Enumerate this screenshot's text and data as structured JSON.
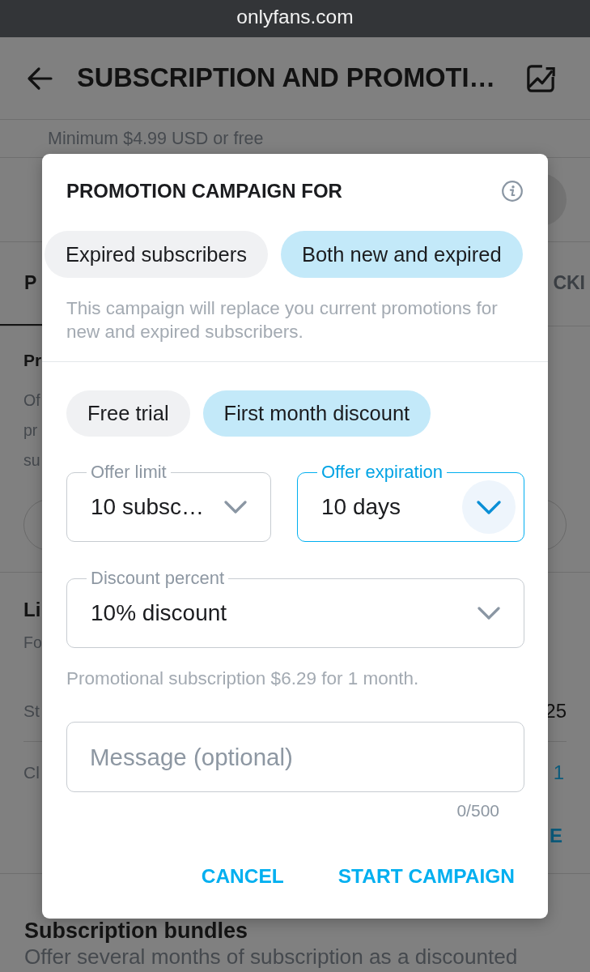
{
  "browser_bar": {
    "url": "onlyfans.com"
  },
  "header": {
    "title": "SUBSCRIPTION AND PROMOTI…"
  },
  "page": {
    "price_note": "Minimum $4.99 USD or free",
    "tabs": [
      {
        "label": "P",
        "selected": true
      },
      {
        "label": "CKI",
        "selected": false
      }
    ],
    "promotions": {
      "title": "Pr",
      "description_lines": [
        "Of",
        "pr",
        "su"
      ]
    },
    "limits": {
      "title": "Li",
      "description": "Fo",
      "rows": [
        {
          "label": "St",
          "value": "25",
          "kind": "plain"
        },
        {
          "label": "Cl",
          "value": "1",
          "kind": "link"
        }
      ],
      "action": "E"
    },
    "bundles": {
      "title": "Subscription bundles",
      "description": "Offer several months of subscription as a discounted"
    }
  },
  "dialog": {
    "title": "PROMOTION CAMPAIGN FOR",
    "audience_options": [
      {
        "label": "Expired subscribers",
        "selected": false
      },
      {
        "label": "Both new and expired",
        "selected": true
      }
    ],
    "note": "This campaign will replace you current promotions for new and expired subscribers.",
    "offer_types": [
      {
        "label": "Free trial",
        "selected": false
      },
      {
        "label": "First month discount",
        "selected": true
      }
    ],
    "offer_limit": {
      "label": "Offer limit",
      "value": "10 subsc…",
      "focused": false
    },
    "offer_expiration": {
      "label": "Offer expiration",
      "value": "10 days",
      "focused": true
    },
    "discount_percent": {
      "label": "Discount percent",
      "value": "10% discount",
      "focused": false
    },
    "summary": "Promotional subscription $6.29 for 1 month.",
    "message": {
      "placeholder": "Message (optional)",
      "counter": "0/500"
    },
    "buttons": [
      "CANCEL",
      "START CAMPAIGN"
    ]
  }
}
